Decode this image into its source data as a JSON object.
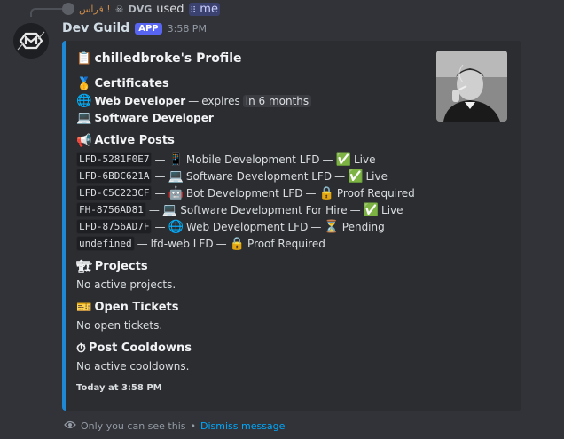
{
  "reply": {
    "user_name": "فراس !",
    "user_tag": "DVG",
    "action": "used",
    "command": "me"
  },
  "message": {
    "author": "Dev Guild",
    "badge": "APP",
    "timestamp": "3:58 PM"
  },
  "embed": {
    "accent_color": "#1e88d4",
    "title": "chilledbroke's Profile",
    "certificates_heading": "Certificates",
    "certificates": [
      {
        "name": "Web Developer",
        "separator": "—",
        "expires_label": "expires",
        "expires_value": "in 6 months"
      },
      {
        "name": "Software Developer"
      }
    ],
    "posts_heading": "Active Posts",
    "posts": [
      {
        "id": "LFD-5281F0E7",
        "title": "Mobile Development LFD",
        "status": "Live"
      },
      {
        "id": "LFD-6BDC621A",
        "title": "Software Development LFD",
        "status": "Live"
      },
      {
        "id": "LFD-C5C223CF",
        "title": "Bot Development LFD",
        "status": "Proof Required"
      },
      {
        "id": "FH-8756AD81",
        "title": "Software Development For Hire",
        "status": "Live"
      },
      {
        "id": "LFD-8756AD7F",
        "title": "Web Development LFD",
        "status": "Pending"
      },
      {
        "id": "undefined",
        "title": "lfd-web LFD",
        "status": "Proof Required"
      }
    ],
    "sep": "—",
    "projects_heading": "Projects",
    "projects_text": "No active projects.",
    "tickets_heading": "Open Tickets",
    "tickets_text": "No open tickets.",
    "cooldowns_heading": "Post Cooldowns",
    "cooldowns_text": "No active cooldowns.",
    "footer": "Today at 3:58 PM"
  },
  "ephemeral": {
    "notice": "Only you can see this",
    "dot": "•",
    "dismiss": "Dismiss message"
  },
  "icons": {
    "title": "clipboard-icon",
    "certificates": "medal-icon",
    "web": "globe-icon",
    "software": "laptop-icon",
    "posts": "megaphone-icon",
    "projects": "construction-icon",
    "tickets": "ticket-icon",
    "cooldowns": "stopwatch-icon"
  }
}
